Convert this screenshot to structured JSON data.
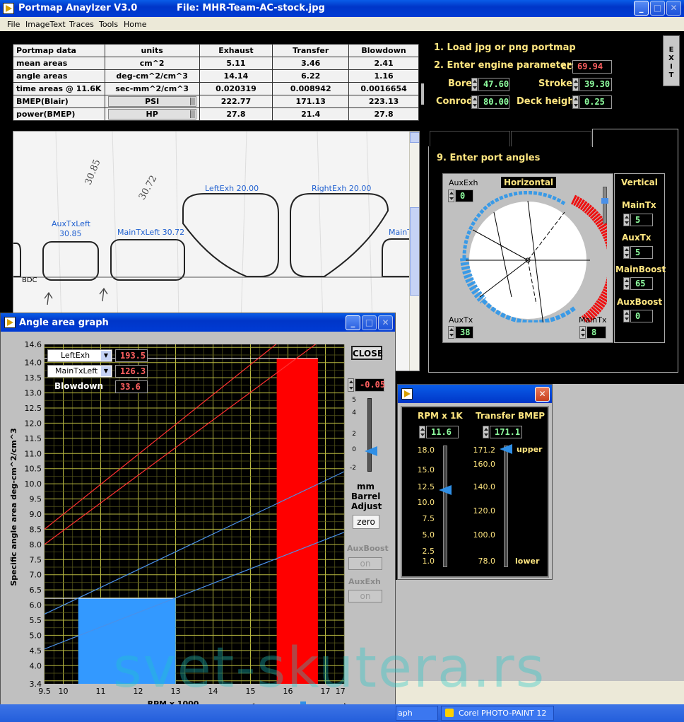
{
  "main_window": {
    "app_title": "Portmap Anaylzer V3.0",
    "file_label": "File: MHR-Team-AC-stock.jpg",
    "menu": [
      "File",
      "ImageText",
      "Traces",
      "Tools",
      "Home"
    ],
    "exit_label": "EXIT"
  },
  "table": {
    "headers": [
      "Portmap data",
      "units",
      "Exhaust",
      "Transfer",
      "Blowdown"
    ],
    "rows": [
      [
        "mean areas",
        "cm^2",
        "5.11",
        "3.46",
        "2.41"
      ],
      [
        "angle areas",
        "deg-cm^2/cm^3",
        "14.14",
        "6.22",
        "1.16"
      ],
      [
        "time areas @ 11.6K",
        "sec-mm^2/cm^3",
        "0.020319",
        "0.008942",
        "0.0016654"
      ],
      [
        "BMEP(Blair)",
        "PSI",
        "222.77",
        "171.13",
        "223.13"
      ],
      [
        "power(BMEP)",
        "HP",
        "27.8",
        "21.4",
        "27.8"
      ]
    ]
  },
  "engine": {
    "step1": "1. Load jpg or png portmap",
    "step2": "2. Enter engine parameters",
    "cc_label": "cc",
    "cc_value": "69.94",
    "bore_label": "Bore",
    "bore_value": "47.60",
    "stroke_label": "Stroke",
    "stroke_value": "39.30",
    "conrod_label": "Conrod",
    "conrod_value": "80.00",
    "deck_label": "Deck height",
    "deck_value": "0.25"
  },
  "ports": {
    "step9": "9. Enter port angles",
    "horizontal_label": "Horizontal",
    "vertical_label": "Vertical",
    "auxexh_label": "AuxExh",
    "auxexh_value": "0",
    "auxtx_left_label": "AuxTx",
    "auxtx_left_value": "38",
    "maintx_bottom_label": "MainTx",
    "maintx_bottom_value": "8",
    "v_maintx_label": "MainTx",
    "v_maintx_value": "5",
    "v_auxtx_label": "AuxTx",
    "v_auxtx_value": "5",
    "v_mainboost_label": "MainBoost",
    "v_mainboost_value": "65",
    "v_auxboost_label": "AuxBoost",
    "v_auxboost_value": "0"
  },
  "portmap_labels": {
    "leftexh": "LeftExh 20.00",
    "rightexh": "RightExh 20.00",
    "auxtxleft": "AuxTxLeft",
    "auxtxleft_val": "30.85",
    "maintxleft": "MainTxLeft 30.72",
    "maintx_partial": "MainT",
    "bdc": "BDC",
    "hand1": "30.85",
    "hand2": "30.72"
  },
  "angle_graph": {
    "title": "Angle area graph",
    "dd1_label": "LeftExh",
    "dd1_value": "193.5",
    "dd2_label": "MainTxLeft",
    "dd2_value": "126.3",
    "blowdown_label": "Blowdown",
    "blowdown_value": "33.6",
    "close_label": "CLOSE",
    "barrel_value": "-0.05",
    "barrel_ticks": [
      "5",
      "4",
      "2",
      "0",
      "-2"
    ],
    "mm_label": "mm",
    "barrel_label": "Barrel",
    "adjust_label": "Adjust",
    "zero_label": "zero",
    "auxboost_label": "AuxBoost",
    "auxboost_btn": "on",
    "auxexh_label": "AuxExh",
    "auxexh_btn": "on",
    "ylabel": "Specific angle area  deg-cm^2/cm^3",
    "xlabel": "RPM x 1000"
  },
  "rpm_window": {
    "rpm_label": "RPM x 1K",
    "rpm_value": "11.6",
    "bmep_label": "Transfer BMEP",
    "bmep_value": "171.1",
    "rpm_ticks": [
      "18.0",
      "15.0",
      "12.5",
      "10.0",
      "7.5",
      "5.0",
      "2.5",
      "1.0"
    ],
    "bmep_ticks": [
      "171.2",
      "160.0",
      "140.0",
      "120.0",
      "100.0",
      "78.0"
    ],
    "upper_label": "upper",
    "lower_label": "lower"
  },
  "taskbar": {
    "item1": "aph",
    "item2": "Corel PHOTO-PAINT 12"
  },
  "watermark": "svet-skutera.rs",
  "chart_data": {
    "type": "line",
    "title": "",
    "xlabel": "RPM x 1000",
    "ylabel": "Specific angle area  deg-cm^2/cm^3",
    "xlim": [
      9.5,
      17.5
    ],
    "ylim": [
      3.4,
      14.6
    ],
    "x_ticks": [
      "9.5",
      "10",
      "11",
      "12",
      "13",
      "14",
      "15",
      "16",
      "17",
      "17.5"
    ],
    "y_ticks": [
      "3.4",
      "4.0",
      "4.5",
      "5.0",
      "5.5",
      "6.0",
      "6.5",
      "7.0",
      "7.5",
      "8.0",
      "8.5",
      "9.0",
      "9.5",
      "10.0",
      "10.5",
      "11.0",
      "11.5",
      "12.0",
      "12.5",
      "13.0",
      "13.5",
      "14.0",
      "14.6"
    ],
    "grid": true,
    "series": [
      {
        "color": "#ff3030",
        "x": [
          9.5,
          17.5
        ],
        "y": [
          8.5,
          16.4
        ]
      },
      {
        "color": "#ff3030",
        "x": [
          9.5,
          17.5
        ],
        "y": [
          8.0,
          15.3
        ]
      },
      {
        "color": "#4a90e8",
        "x": [
          9.5,
          17.5
        ],
        "y": [
          5.7,
          10.4
        ]
      },
      {
        "color": "#4a90e8",
        "x": [
          9.5,
          17.5
        ],
        "y": [
          4.55,
          8.4
        ]
      }
    ],
    "bars": [
      {
        "color": "#3399ff",
        "x0": 10.4,
        "x1": 13.0,
        "y": 6.22
      },
      {
        "color": "#ff0000",
        "x0": 15.7,
        "x1": 16.8,
        "y": 14.14
      }
    ]
  }
}
